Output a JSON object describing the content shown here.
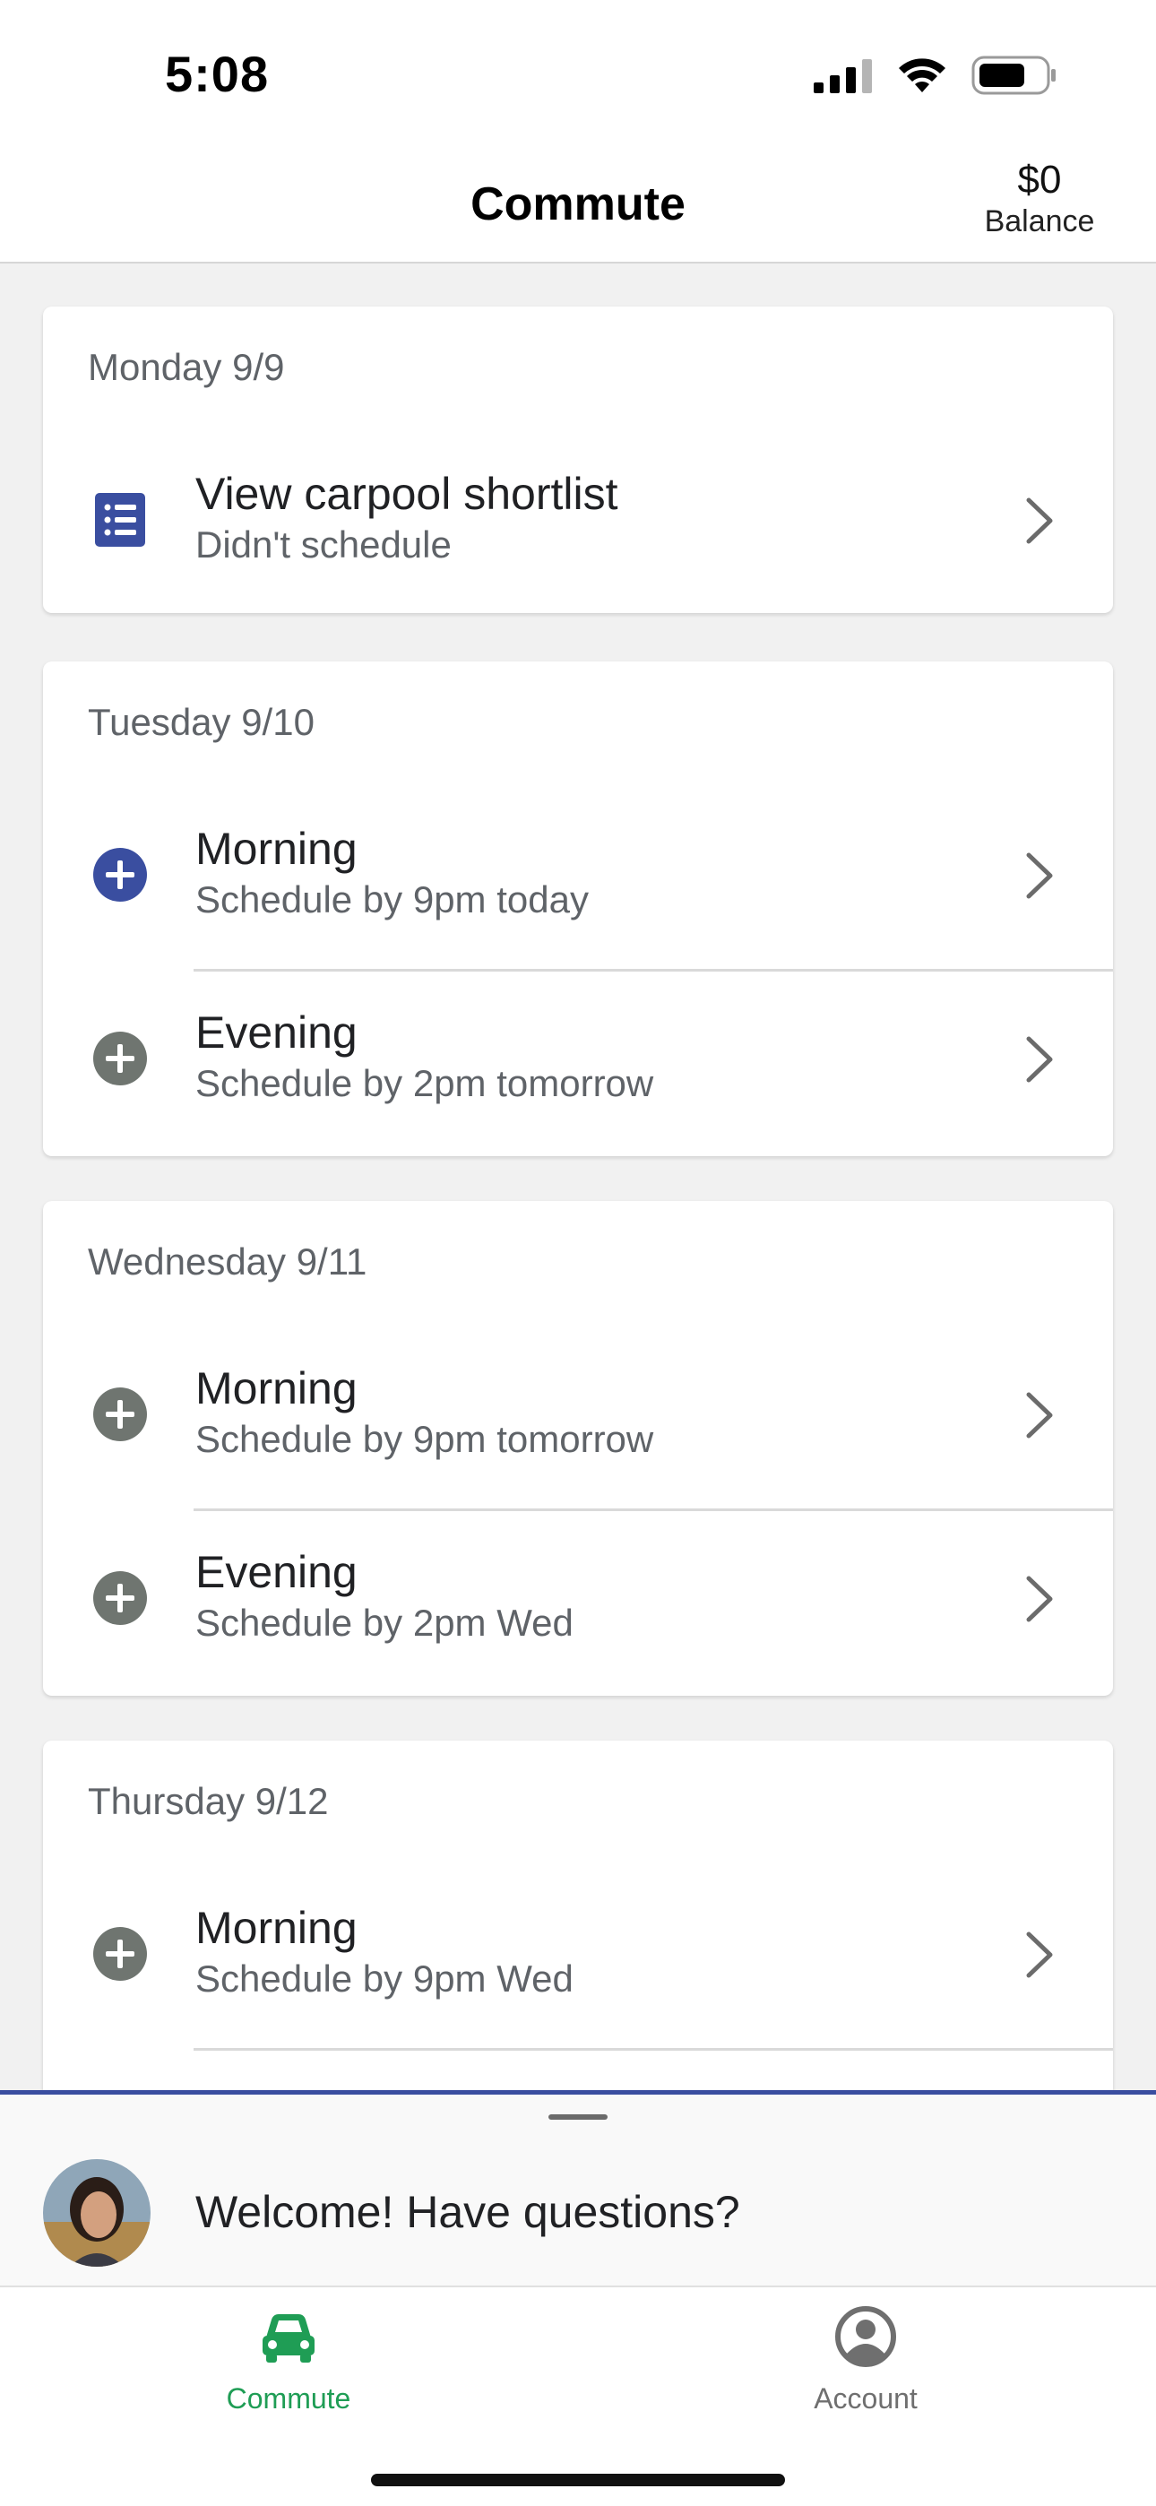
{
  "status_bar": {
    "time": "5:08"
  },
  "header": {
    "title": "Commute",
    "balance_amount": "$0",
    "balance_label": "Balance"
  },
  "days": [
    {
      "heading": "Monday 9/9",
      "rows": [
        {
          "title": "View carpool shortlist",
          "subtitle": "Didn't schedule",
          "icon": "list-icon"
        }
      ]
    },
    {
      "heading": "Tuesday 9/10",
      "rows": [
        {
          "title": "Morning",
          "subtitle": "Schedule by 9pm today",
          "icon": "add-circle-icon",
          "state": "active"
        },
        {
          "title": "Evening",
          "subtitle": "Schedule by 2pm tomorrow",
          "icon": "add-circle-icon",
          "state": "inactive"
        }
      ]
    },
    {
      "heading": "Wednesday 9/11",
      "rows": [
        {
          "title": "Morning",
          "subtitle": "Schedule by 9pm tomorrow",
          "icon": "add-circle-icon",
          "state": "inactive"
        },
        {
          "title": "Evening",
          "subtitle": "Schedule by 2pm Wed",
          "icon": "add-circle-icon",
          "state": "inactive"
        }
      ]
    },
    {
      "heading": "Thursday 9/12",
      "rows": [
        {
          "title": "Morning",
          "subtitle": "Schedule by 9pm Wed",
          "icon": "add-circle-icon",
          "state": "inactive"
        }
      ]
    }
  ],
  "bottom_sheet": {
    "welcome_text": "Welcome! Have questions?"
  },
  "tab_bar": {
    "tabs": [
      {
        "label": "Commute",
        "icon": "car-icon",
        "selected": true
      },
      {
        "label": "Account",
        "icon": "account-circle-icon",
        "selected": false
      }
    ]
  },
  "colors": {
    "accent_blue": "#3a4ea0",
    "inactive_icon": "#6f7570",
    "tab_selected": "#1f9d55",
    "tab_unselected": "#6f6f6f",
    "background": "#f1f1f1"
  }
}
